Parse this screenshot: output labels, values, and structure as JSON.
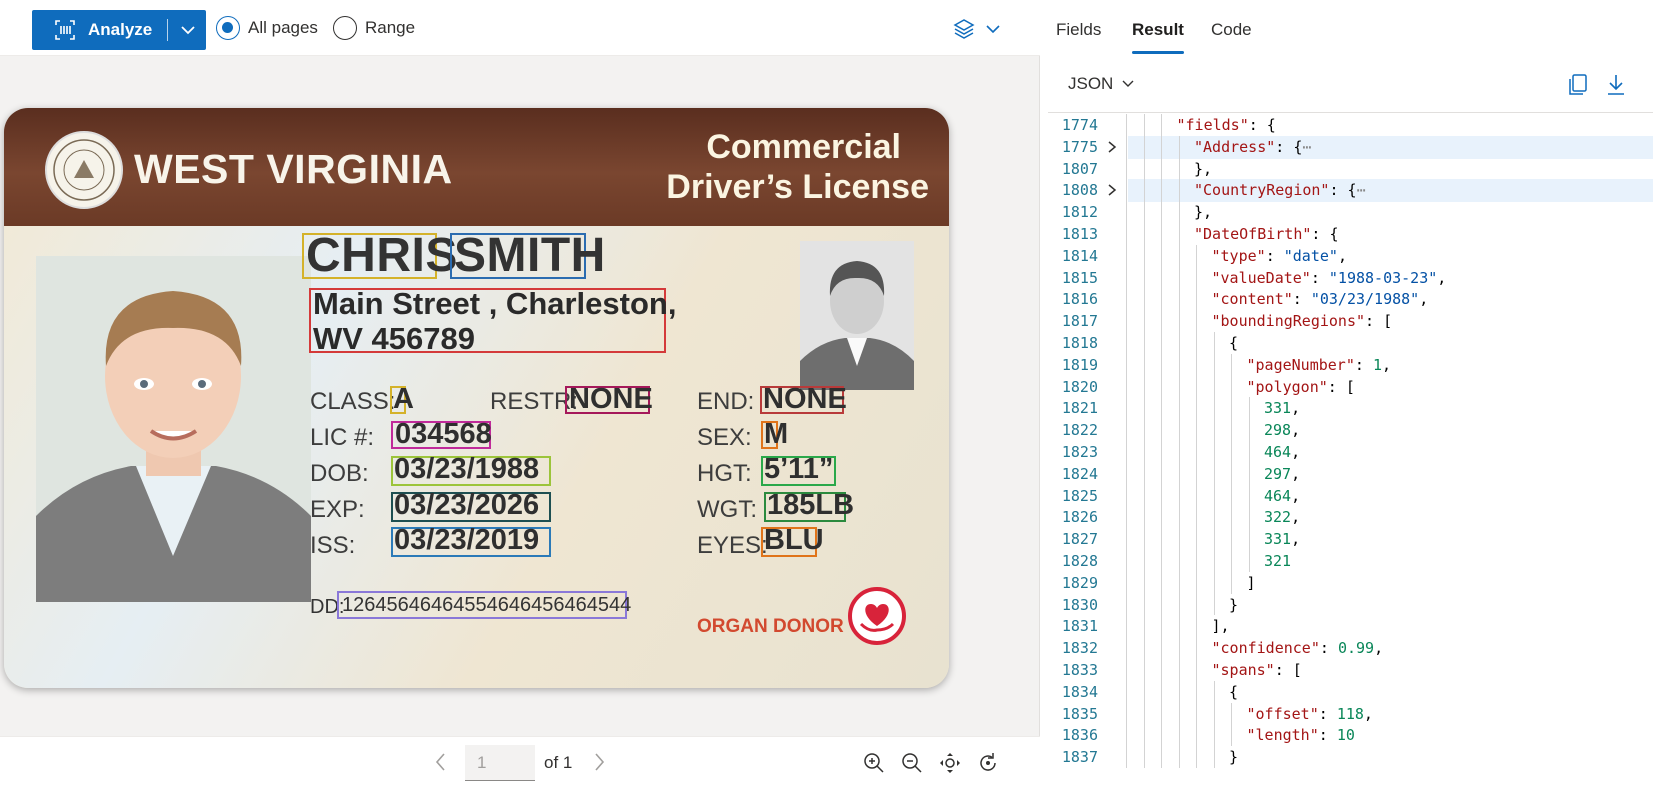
{
  "toolbar": {
    "analyze_label": "Analyze",
    "radio_all": "All pages",
    "radio_range": "Range",
    "selected": "All pages"
  },
  "card": {
    "state": "WEST VIRGINIA",
    "title_line1": "Commercial",
    "title_line2": "Driver’s License",
    "first_name": "CHRIS",
    "last_name": "SMITH",
    "address_line1": "Main Street , Charleston,",
    "address_line2": "WV 456789",
    "fields": [
      {
        "label": "CLASS:",
        "value": "A"
      },
      {
        "label": "RESTR:",
        "value": "NONE"
      },
      {
        "label": "END:",
        "value": "NONE"
      },
      {
        "label": "LIC #:",
        "value": "034568"
      },
      {
        "label": "SEX:",
        "value": "M"
      },
      {
        "label": "DOB:",
        "value": "03/23/1988"
      },
      {
        "label": "HGT:",
        "value": "5’11”"
      },
      {
        "label": "EXP:",
        "value": "03/23/2026"
      },
      {
        "label": "WGT:",
        "value": "185LB"
      },
      {
        "label": "ISS:",
        "value": "03/23/2019"
      },
      {
        "label": "EYES:",
        "value": "BLU"
      }
    ],
    "dd_label": "DD:",
    "dd_value": "12645646464554646456464544",
    "organ_donor": "ORGAN DONOR"
  },
  "pager": {
    "page_placeholder": "1",
    "of_label": "of 1"
  },
  "right": {
    "tabs": [
      "Fields",
      "Result",
      "Code"
    ],
    "active_tab": "Result",
    "format": "JSON"
  },
  "colors": {
    "accent": "#0f6cbd",
    "json_key": "#a31515",
    "json_string": "#0451a5",
    "json_number": "#098658",
    "line_number": "#237893"
  },
  "code_lines": [
    {
      "n": "1774",
      "indent": 4,
      "parts": [
        [
          "k",
          "\"fields\""
        ],
        [
          "p",
          ": {"
        ]
      ]
    },
    {
      "n": "1775",
      "indent": 5,
      "fold": true,
      "hl": true,
      "parts": [
        [
          "k",
          "\"Address\""
        ],
        [
          "p",
          ": {"
        ],
        [
          "el",
          "⋯"
        ]
      ]
    },
    {
      "n": "1807",
      "indent": 5,
      "parts": [
        [
          "p",
          "},"
        ]
      ]
    },
    {
      "n": "1808",
      "indent": 5,
      "fold": true,
      "hl": true,
      "parts": [
        [
          "k",
          "\"CountryRegion\""
        ],
        [
          "p",
          ": {"
        ],
        [
          "el",
          "⋯"
        ]
      ]
    },
    {
      "n": "1812",
      "indent": 5,
      "parts": [
        [
          "p",
          "},"
        ]
      ]
    },
    {
      "n": "1813",
      "indent": 5,
      "parts": [
        [
          "k",
          "\"DateOfBirth\""
        ],
        [
          "p",
          ": {"
        ]
      ]
    },
    {
      "n": "1814",
      "indent": 6,
      "parts": [
        [
          "k",
          "\"type\""
        ],
        [
          "p",
          ": "
        ],
        [
          "s",
          "\"date\""
        ],
        [
          "p",
          ","
        ]
      ]
    },
    {
      "n": "1815",
      "indent": 6,
      "parts": [
        [
          "k",
          "\"valueDate\""
        ],
        [
          "p",
          ": "
        ],
        [
          "s",
          "\"1988-03-23\""
        ],
        [
          "p",
          ","
        ]
      ]
    },
    {
      "n": "1816",
      "indent": 6,
      "parts": [
        [
          "k",
          "\"content\""
        ],
        [
          "p",
          ": "
        ],
        [
          "s",
          "\"03/23/1988\""
        ],
        [
          "p",
          ","
        ]
      ]
    },
    {
      "n": "1817",
      "indent": 6,
      "parts": [
        [
          "k",
          "\"boundingRegions\""
        ],
        [
          "p",
          ": ["
        ]
      ]
    },
    {
      "n": "1818",
      "indent": 7,
      "parts": [
        [
          "p",
          "{"
        ]
      ]
    },
    {
      "n": "1819",
      "indent": 8,
      "parts": [
        [
          "k",
          "\"pageNumber\""
        ],
        [
          "p",
          ": "
        ],
        [
          "n",
          "1"
        ],
        [
          "p",
          ","
        ]
      ]
    },
    {
      "n": "1820",
      "indent": 8,
      "parts": [
        [
          "k",
          "\"polygon\""
        ],
        [
          "p",
          ": ["
        ]
      ]
    },
    {
      "n": "1821",
      "indent": 9,
      "parts": [
        [
          "n",
          "331"
        ],
        [
          "p",
          ","
        ]
      ]
    },
    {
      "n": "1822",
      "indent": 9,
      "parts": [
        [
          "n",
          "298"
        ],
        [
          "p",
          ","
        ]
      ]
    },
    {
      "n": "1823",
      "indent": 9,
      "parts": [
        [
          "n",
          "464"
        ],
        [
          "p",
          ","
        ]
      ]
    },
    {
      "n": "1824",
      "indent": 9,
      "parts": [
        [
          "n",
          "297"
        ],
        [
          "p",
          ","
        ]
      ]
    },
    {
      "n": "1825",
      "indent": 9,
      "parts": [
        [
          "n",
          "464"
        ],
        [
          "p",
          ","
        ]
      ]
    },
    {
      "n": "1826",
      "indent": 9,
      "parts": [
        [
          "n",
          "322"
        ],
        [
          "p",
          ","
        ]
      ]
    },
    {
      "n": "1827",
      "indent": 9,
      "parts": [
        [
          "n",
          "331"
        ],
        [
          "p",
          ","
        ]
      ]
    },
    {
      "n": "1828",
      "indent": 9,
      "parts": [
        [
          "n",
          "321"
        ]
      ]
    },
    {
      "n": "1829",
      "indent": 8,
      "parts": [
        [
          "p",
          "]"
        ]
      ]
    },
    {
      "n": "1830",
      "indent": 7,
      "parts": [
        [
          "p",
          "}"
        ]
      ]
    },
    {
      "n": "1831",
      "indent": 6,
      "parts": [
        [
          "p",
          "],"
        ]
      ]
    },
    {
      "n": "1832",
      "indent": 6,
      "parts": [
        [
          "k",
          "\"confidence\""
        ],
        [
          "p",
          ": "
        ],
        [
          "n",
          "0.99"
        ],
        [
          "p",
          ","
        ]
      ]
    },
    {
      "n": "1833",
      "indent": 6,
      "parts": [
        [
          "k",
          "\"spans\""
        ],
        [
          "p",
          ": ["
        ]
      ]
    },
    {
      "n": "1834",
      "indent": 7,
      "parts": [
        [
          "p",
          "{"
        ]
      ]
    },
    {
      "n": "1835",
      "indent": 8,
      "parts": [
        [
          "k",
          "\"offset\""
        ],
        [
          "p",
          ": "
        ],
        [
          "n",
          "118"
        ],
        [
          "p",
          ","
        ]
      ]
    },
    {
      "n": "1836",
      "indent": 8,
      "parts": [
        [
          "k",
          "\"length\""
        ],
        [
          "p",
          ": "
        ],
        [
          "n",
          "10"
        ]
      ]
    },
    {
      "n": "1837",
      "indent": 7,
      "parts": [
        [
          "p",
          "}"
        ]
      ]
    }
  ]
}
